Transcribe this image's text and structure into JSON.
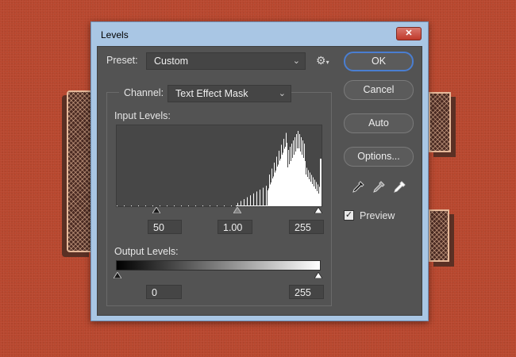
{
  "window": {
    "title": "Levels",
    "close_glyph": "✕"
  },
  "preset": {
    "label": "Preset:",
    "value": "Custom",
    "menu_icon": "gear-icon"
  },
  "channel": {
    "label": "Channel:",
    "value": "Text Effect Mask"
  },
  "input_levels": {
    "label": "Input Levels:",
    "shadow": "50",
    "midtone": "1.00",
    "highlight": "255",
    "histogram_icon": "histogram"
  },
  "output_levels": {
    "label": "Output Levels:",
    "shadow": "0",
    "highlight": "255"
  },
  "buttons": {
    "ok": "OK",
    "cancel": "Cancel",
    "auto": "Auto",
    "options": "Options..."
  },
  "eyedroppers": [
    "black-eyedropper-icon",
    "gray-eyedropper-icon",
    "white-eyedropper-icon"
  ],
  "preview": {
    "label": "Preview",
    "checked": true
  },
  "colors": {
    "panel": "#535353",
    "titlebar": "#a9c6e4",
    "accent": "#4a7ed1",
    "close": "#c0392b",
    "background": "#b8472e"
  }
}
